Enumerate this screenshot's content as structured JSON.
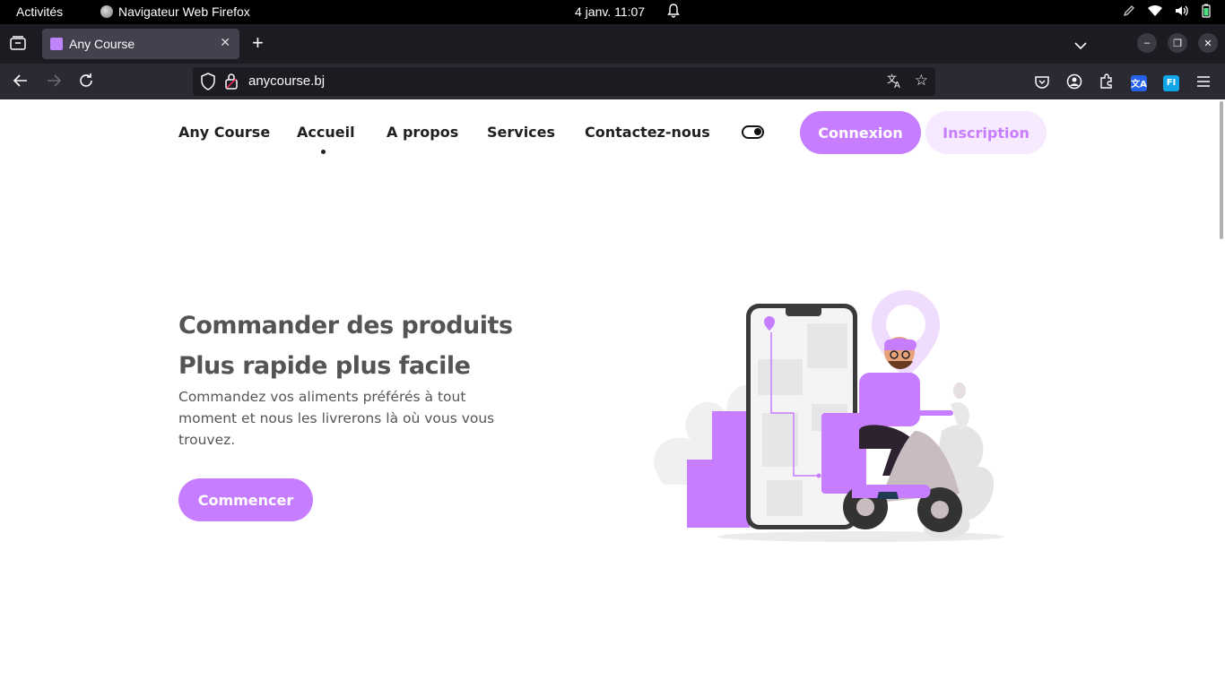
{
  "system": {
    "activities": "Activités",
    "app_name": "Navigateur Web Firefox",
    "clock": "4 janv.  11:07"
  },
  "browser": {
    "tab_title": "Any Course",
    "url": "anycourse.bj"
  },
  "site": {
    "brand": "Any Course",
    "nav": {
      "home": "Accueil",
      "about": "A propos",
      "services": "Services",
      "contact": "Contactez-nous"
    },
    "login": "Connexion",
    "signup": "Inscription",
    "hero": {
      "title_line1": "Commander des produits",
      "title_line2": "Plus rapide plus facile",
      "subtitle": "Commandez vos aliments préférés à tout moment et nous les livrerons là où vous vous trouvez.",
      "cta": "Commencer"
    }
  },
  "colors": {
    "accent": "#c77dff",
    "accent_light": "#f7eafe"
  }
}
